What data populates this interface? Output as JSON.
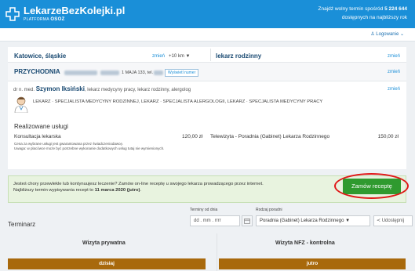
{
  "header": {
    "logo_title": "LekarzeBezKolejki.pl",
    "logo_sub_prefix": "PLATFORMA",
    "logo_sub_brand": "OSOZ",
    "right_line1_prefix": "Znajdź wolny termin spośród",
    "right_count": "5 224 644",
    "right_line2": "dostępnych na najbliższy rok"
  },
  "userbar": {
    "login": "♙ Logowanie ⌄"
  },
  "search": {
    "location": "Katowice, śląskie",
    "location_change": "zmień",
    "radius": "+10 km ▼",
    "specialty": "lekarz rodzinny",
    "specialty_change": "zmień"
  },
  "clinic": {
    "name": "PRZYCHODNIA",
    "address": "1 MAJA 133, tel.",
    "map_button": "Wyświetl numer",
    "change": "zmień"
  },
  "doctor": {
    "prefix": "dr n. med.",
    "name": "Szymon Iksiński",
    "roles": "lekarz medycyny pracy, lekarz rodzinny, alergolog",
    "change": "zmień",
    "specializations": "LEKARZ · SPECJALISTA MEDYCYNY RODZINNEJ, LEKARZ · SPECJALISTA ALERGOLOGII, LEKARZ · SPECJALISTA MEDYCYNY PRACY"
  },
  "services": {
    "title": "Realizowane usługi",
    "items": [
      {
        "name": "Konsultacja lekarska",
        "price": "120,00 zł"
      },
      {
        "name": "Telewizyta - Poradnia (Gabinet) Lekarza Rodzinnego",
        "price": "150,00 zł"
      }
    ],
    "notes": [
      "Cena za wybrane usługi jest gwarantowana przez świadczeniodawcę.",
      "Uwaga: w placówce może być potrzebne wykonanie dodatkowych usług tutaj nie wymienionych."
    ]
  },
  "info": {
    "line1": "Jesteś chory przewlekle lub kontynuujesz leczenie? Zamów on-line receptę u swojego lekarza prowadzącego przez internet.",
    "line2_prefix": "Najbliższy termin wypisywania recept to",
    "line2_date": "11 marca 2020 (jutro)",
    "line2_suffix": ".",
    "order_button": "Zamów receptę"
  },
  "schedule": {
    "title": "Terminarz",
    "date_label": "Terminy od dnia",
    "date_placeholder": "dd . mm . rrrr",
    "clinic_label": "Rodzaj poradni",
    "clinic_value": "Poradnia (Gabinet) Lekarza Rodzinnego ▼",
    "share": "Udostępnij",
    "col1_title": "Wizyta prywatna",
    "col2_title": "Wizyta NFZ - kontrolna",
    "col1_day": "dzisiaj",
    "col2_day": "jutro"
  },
  "colors": {
    "header": "#1a8fd8",
    "order_button": "#2f9a2f",
    "day_bar": "#a8690c",
    "highlight_ring": "#e01818"
  }
}
